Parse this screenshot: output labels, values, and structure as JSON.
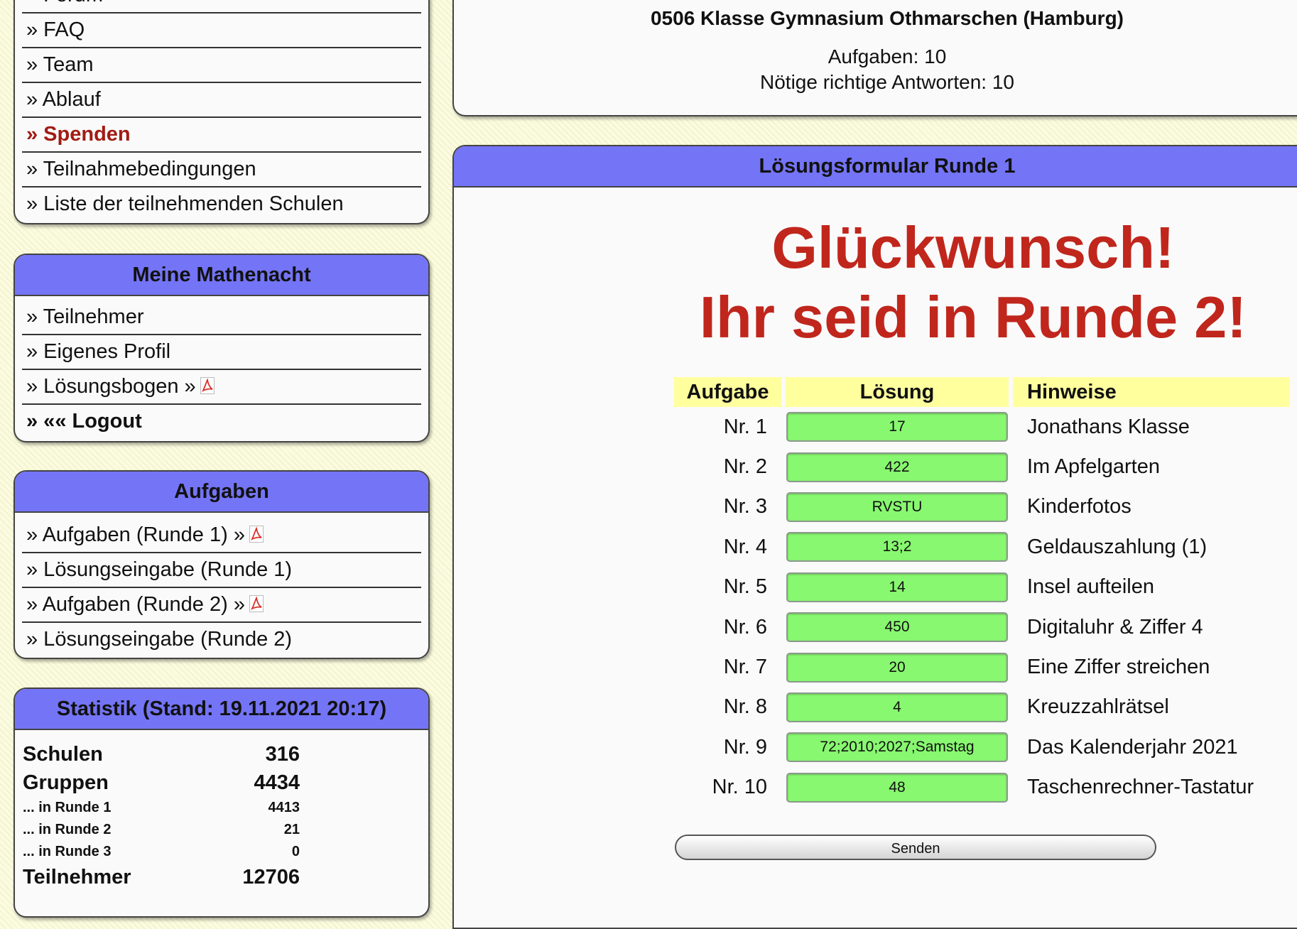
{
  "nav_top": {
    "items": [
      "» Forum",
      "» FAQ",
      "» Team",
      "» Ablauf",
      "» Spenden",
      "» Teilnahmebedingungen",
      "» Liste der teilnehmenden Schulen"
    ]
  },
  "meine": {
    "title": "Meine Mathenacht",
    "items": [
      "» Teilnehmer",
      "» Eigenes Profil",
      "» Lösungsbogen »",
      "» «« Logout"
    ]
  },
  "aufgaben": {
    "title": "Aufgaben",
    "items": [
      "» Aufgaben (Runde 1) »",
      "» Lösungseingabe (Runde 1)",
      "» Aufgaben (Runde 2) »",
      "» Lösungseingabe (Runde 2)"
    ]
  },
  "statistik": {
    "title": "Statistik (Stand: 19.11.2021 20:17)",
    "rows": [
      {
        "label": "Schulen",
        "value": "316"
      },
      {
        "label": "Gruppen",
        "value": "4434"
      },
      {
        "label": "... in Runde 1",
        "value": "4413"
      },
      {
        "label": "... in Runde 2",
        "value": "21"
      },
      {
        "label": "... in Runde 3",
        "value": "0"
      },
      {
        "label": "Teilnehmer",
        "value": "12706"
      }
    ]
  },
  "info": {
    "class_name": "0506 Klasse Gymnasium Othmarschen (Hamburg)",
    "aufgaben": "Aufgaben: 10",
    "noetig": "Nötige richtige Antworten: 10"
  },
  "form": {
    "title": "Lösungsformular Runde 1",
    "congrats_line1": "Glückwunsch!",
    "congrats_line2": "Ihr seid in Runde 2!",
    "headers": {
      "aufgabe": "Aufgabe",
      "loesung": "Lösung",
      "hinweise": "Hinweise"
    },
    "rows": [
      {
        "nr": "Nr. 1",
        "answer": "17",
        "hint": "Jonathans Klasse"
      },
      {
        "nr": "Nr. 2",
        "answer": "422",
        "hint": "Im Apfelgarten"
      },
      {
        "nr": "Nr. 3",
        "answer": "RVSTU",
        "hint": "Kinderfotos"
      },
      {
        "nr": "Nr. 4",
        "answer": "13;2",
        "hint": "Geldauszahlung (1)"
      },
      {
        "nr": "Nr. 5",
        "answer": "14",
        "hint": "Insel aufteilen"
      },
      {
        "nr": "Nr. 6",
        "answer": "450",
        "hint": "Digitaluhr & Ziffer 4"
      },
      {
        "nr": "Nr. 7",
        "answer": "20",
        "hint": "Eine Ziffer streichen"
      },
      {
        "nr": "Nr. 8",
        "answer": "4",
        "hint": "Kreuzzahlrätsel"
      },
      {
        "nr": "Nr. 9",
        "answer": "72;2010;2027;Samstag",
        "hint": "Das Kalenderjahr 2021"
      },
      {
        "nr": "Nr. 10",
        "answer": "48",
        "hint": "Taschenrechner-Tastatur"
      }
    ],
    "submit_label": "Senden"
  },
  "colors": {
    "header_blue": "#7474f6",
    "correct_green": "#88f870",
    "congrats_red": "#c0261c",
    "highlight_red": "#a11c14",
    "table_head_yellow": "#ffff9e"
  },
  "icons": {
    "pdf": "pdf-icon"
  }
}
